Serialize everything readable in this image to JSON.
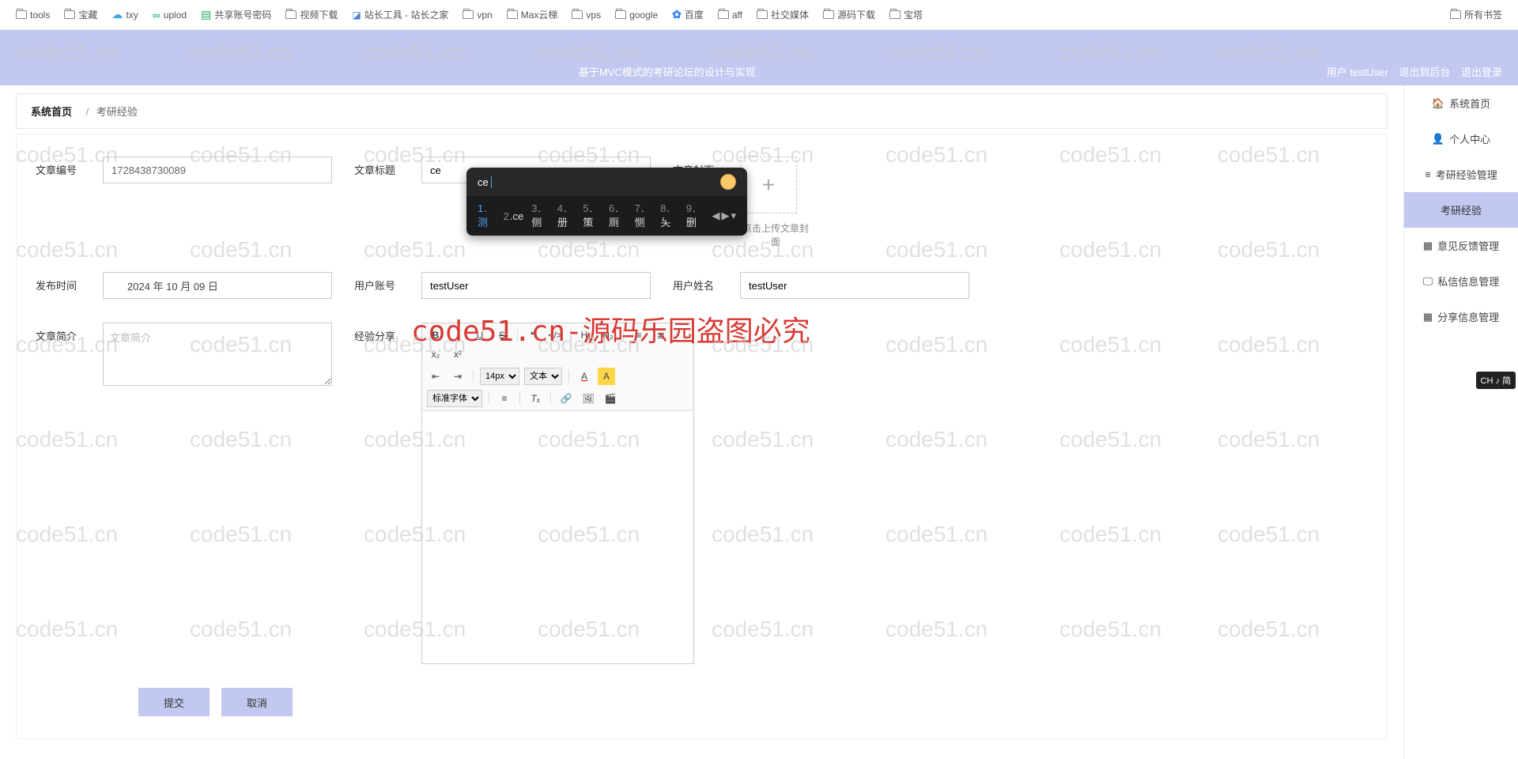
{
  "bookmarks": {
    "items": [
      "tools",
      "宝藏",
      "txy",
      "uplod",
      "共享账号密码",
      "视频下载",
      "站长工具 - 站长之家",
      "vpn",
      "Max云梯",
      "vps",
      "google",
      "百度",
      "aff",
      "社交媒体",
      "源码下载",
      "宝塔"
    ],
    "right": "所有书签"
  },
  "header": {
    "title": "基于MVC模式的考研论坛的设计与实现",
    "userLabel": "用户 testUser",
    "backend": "退出到后台",
    "logout": "退出登录"
  },
  "breadcrumb": {
    "root": "系统首页",
    "current": "考研经验"
  },
  "rightNav": {
    "items": [
      {
        "icon": "🏠",
        "label": "系统首页"
      },
      {
        "icon": "👤",
        "label": "个人中心"
      },
      {
        "icon": "≡",
        "label": "考研经验管理"
      },
      {
        "icon": "",
        "label": "考研经验"
      },
      {
        "icon": "▦",
        "label": "意见反馈管理"
      },
      {
        "icon": "🖵",
        "label": "私信信息管理"
      },
      {
        "icon": "▦",
        "label": "分享信息管理"
      }
    ],
    "activeIndex": 3
  },
  "form": {
    "idLabel": "文章编号",
    "idValue": "1728438730089",
    "titleLabel": "文章标题",
    "titleValue": "ce",
    "coverLabel": "文章封面",
    "coverHint": "点击上传文章封面",
    "dateLabel": "发布时间",
    "dateValue": "2024 年 10 月 09 日",
    "acctLabel": "用户账号",
    "acctValue": "testUser",
    "nameLabel": "用户姓名",
    "nameValue": "testUser",
    "introLabel": "文章简介",
    "introPlaceholder": "文章简介",
    "shareLabel": "经验分享",
    "submit": "提交",
    "cancel": "取消"
  },
  "editorToolbar": {
    "fontSize": "14px",
    "formatLabel": "文本",
    "fontLabel": "标准字体"
  },
  "ime": {
    "typed": "ce",
    "candidates": [
      {
        "n": "1",
        "t": "测"
      },
      {
        "n": "2",
        "t": "ce"
      },
      {
        "n": "3",
        "t": "侧"
      },
      {
        "n": "4",
        "t": "册"
      },
      {
        "n": "5",
        "t": "策"
      },
      {
        "n": "6",
        "t": "厕"
      },
      {
        "n": "7",
        "t": "恻"
      },
      {
        "n": "8",
        "t": "夨"
      },
      {
        "n": "9",
        "t": "删"
      }
    ],
    "indicator": "CH ♪ 简"
  },
  "watermarkText": "code51.cn",
  "bigWatermark": "code51.cn-源码乐园盗图必究"
}
